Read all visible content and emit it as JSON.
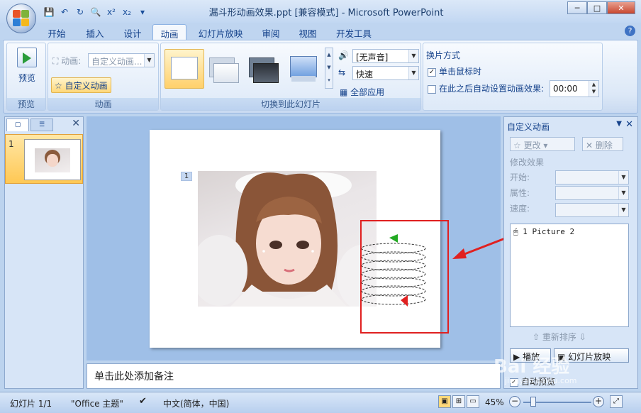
{
  "window": {
    "title": "漏斗形动画效果.ppt [兼容模式] - Microsoft PowerPoint",
    "min": "─",
    "max": "□",
    "close": "✕"
  },
  "tabs": [
    "开始",
    "插入",
    "设计",
    "动画",
    "幻灯片放映",
    "审阅",
    "视图",
    "开发工具"
  ],
  "active_tab": "动画",
  "help": "?",
  "ribbon": {
    "preview": {
      "button": "预览",
      "group": "预览"
    },
    "animation": {
      "anim_label": "动画:",
      "anim_value": "自定义动画...",
      "custom_button": "自定义动画",
      "group": "动画"
    },
    "transition": {
      "sound": "[无声音]",
      "speed": "快速",
      "apply_all": "全部应用",
      "group": "切换到此幻灯片"
    },
    "advance": {
      "title": "换片方式",
      "on_click": "单击鼠标时",
      "after_label": "在此之后自动设置动画效果:",
      "after_value": "00:00",
      "on_click_checked": true,
      "after_checked": false
    }
  },
  "slides_pane": {
    "slide_number": "1"
  },
  "slide": {
    "placeholder_number": "1"
  },
  "notes": {
    "placeholder": "单击此处添加备注"
  },
  "task_pane": {
    "title": "自定义动画",
    "change_button": "更改",
    "delete_button": "删除",
    "modify_label": "修改效果",
    "start_label": "开始:",
    "property_label": "属性:",
    "speed_label": "速度:",
    "list_item": "1 Picture 2",
    "reorder_label": "重新排序",
    "play_button": "播放",
    "slideshow_button": "幻灯片放映",
    "autopreview": "自动预览"
  },
  "status": {
    "slide": "幻灯片 1/1",
    "theme": "\"Office 主题\"",
    "language": "中文(简体，中国)",
    "zoom": "45%"
  },
  "watermark": {
    "text": "Bai 经验",
    "sub": "jingyan.baidu.com"
  }
}
